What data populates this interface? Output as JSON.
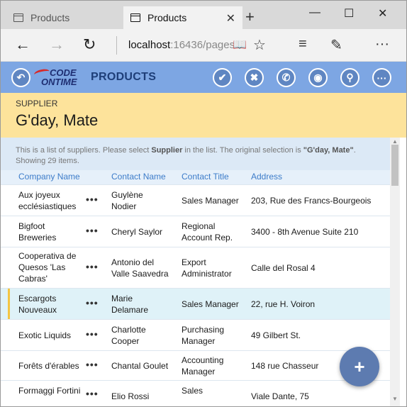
{
  "browser": {
    "tabs": [
      {
        "label": "Products",
        "active": false
      },
      {
        "label": "Products",
        "active": true
      }
    ],
    "new_tab": "+",
    "close_tab": "✕",
    "window_buttons": {
      "minimize": "—",
      "maximize": "☐",
      "close": "✕"
    },
    "nav": {
      "back": "←",
      "forward": "→",
      "refresh": "↻"
    },
    "address": {
      "host": "localhost",
      "rest": ":16436/pages"
    },
    "toolbar": {
      "reading_view": "📖",
      "favorite": "☆",
      "hub": "≡",
      "notes": "✎",
      "more": "···"
    }
  },
  "app": {
    "logo_line1": "CODE",
    "logo_line2": "ONTIME",
    "title": "PRODUCTS",
    "header_buttons": {
      "back": "↶",
      "ok": "✔",
      "cancel": "✖",
      "call": "✆",
      "view": "◉",
      "search": "⚲",
      "more": "···"
    },
    "supplier_label": "SUPPLIER",
    "supplier_value": "G'day, Mate",
    "description": {
      "part1": "This is a list of suppliers. Please select ",
      "bold1": "Supplier",
      "part2": " in the list. The original selection is ",
      "bold2": "\"G'day, Mate\"",
      "part3": ".",
      "line2": "Showing 29 items."
    },
    "columns": [
      "Company Name",
      "Contact Name",
      "Contact Title",
      "Address"
    ],
    "row_menu": "•••",
    "rows": [
      {
        "company": [
          "Aux joyeux",
          "ecclésiastiques"
        ],
        "contact": [
          "Guylène",
          "Nodier"
        ],
        "title": [
          "Sales Manager"
        ],
        "address": "203, Rue des Francs-Bourgeois"
      },
      {
        "company": [
          "Bigfoot",
          "Breweries"
        ],
        "contact": [
          "Cheryl Saylor"
        ],
        "title": [
          "Regional",
          "Account Rep."
        ],
        "address": "3400 - 8th Avenue Suite 210"
      },
      {
        "company": [
          "Cooperativa de",
          "Quesos 'Las",
          "Cabras'"
        ],
        "contact": [
          "Antonio del",
          "Valle Saavedra"
        ],
        "title": [
          "Export",
          "Administrator"
        ],
        "address": "Calle del Rosal 4"
      },
      {
        "company": [
          "Escargots",
          "Nouveaux"
        ],
        "contact": [
          "Marie",
          "Delamare"
        ],
        "title": [
          "Sales Manager"
        ],
        "address": "22, rue H. Voiron"
      },
      {
        "company": [
          "Exotic Liquids"
        ],
        "contact": [
          "Charlotte",
          "Cooper"
        ],
        "title": [
          "Purchasing",
          "Manager"
        ],
        "address": "49 Gilbert St."
      },
      {
        "company": [
          "Forêts d'érables"
        ],
        "contact": [
          "Chantal Goulet"
        ],
        "title": [
          "Accounting",
          "Manager"
        ],
        "address": "148 rue Chasseur"
      },
      {
        "company": [
          "Formaggi Fortini"
        ],
        "contact": [
          "Elio Rossi"
        ],
        "title": [
          "Sales"
        ],
        "address": "Viale Dante, 75"
      }
    ],
    "fab_label": "+",
    "scroll_up": "▲",
    "scroll_down": "▼"
  }
}
